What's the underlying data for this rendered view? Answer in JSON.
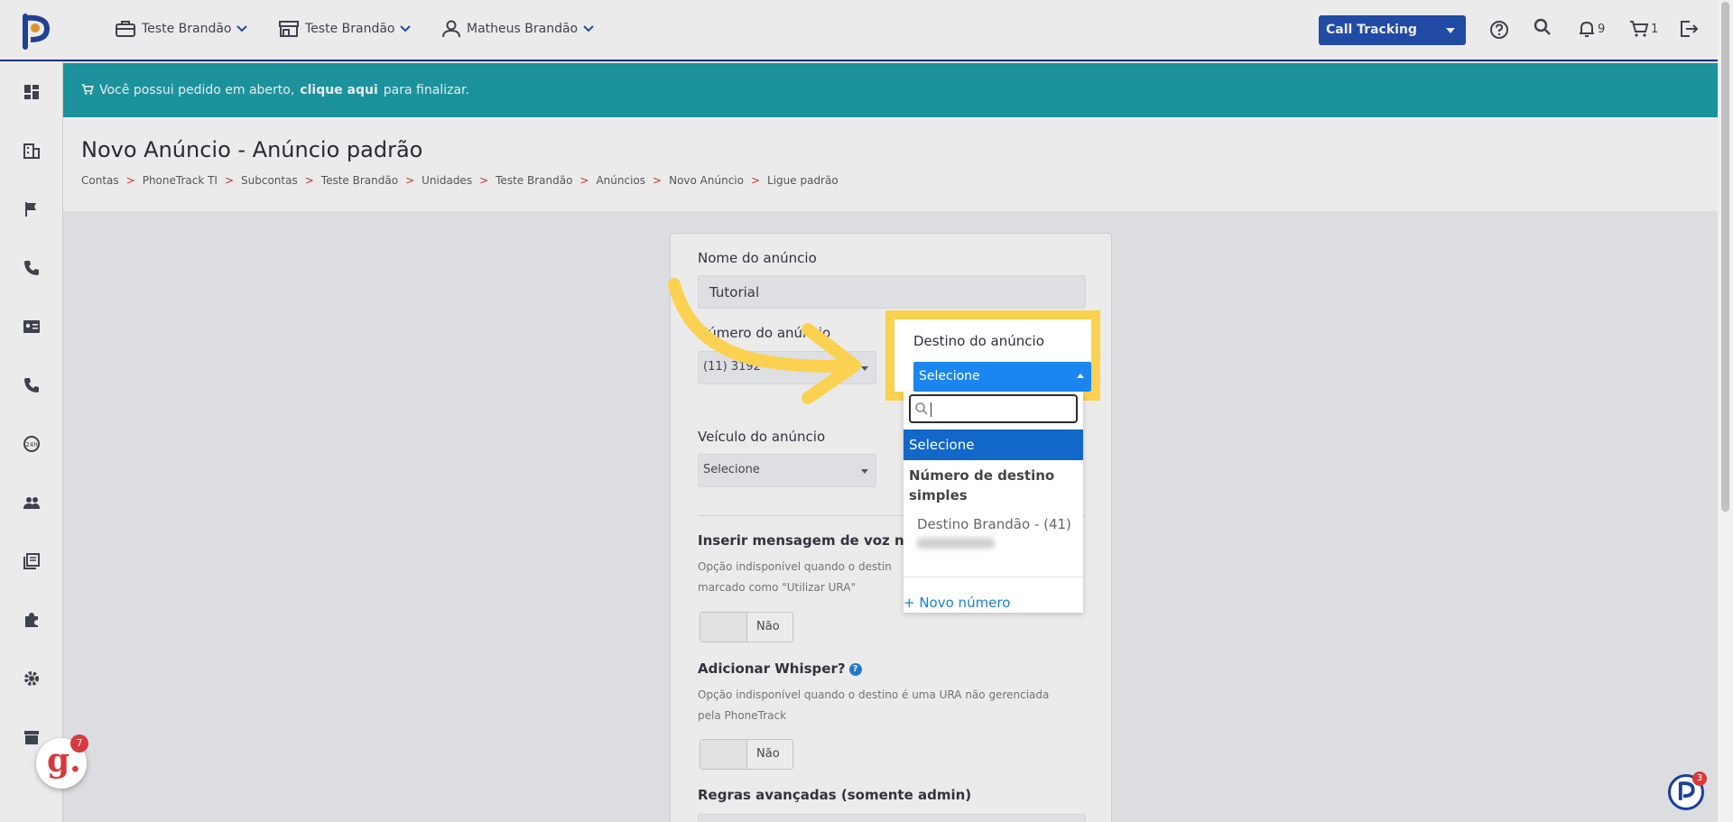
{
  "header": {
    "nav": [
      {
        "label": "Teste Brandão",
        "icon": "briefcase-icon"
      },
      {
        "label": "Teste Brandão",
        "icon": "store-icon"
      },
      {
        "label": "Matheus Brandão",
        "icon": "user-icon"
      }
    ],
    "product_select": "Call Tracking",
    "notifications_count": "9",
    "cart_count": "1"
  },
  "banner": {
    "text_before": "Você possui pedido em aberto,",
    "link": "clique aqui",
    "text_after": "para finalizar."
  },
  "page": {
    "title": "Novo Anúncio - Anúncio padrão",
    "breadcrumb": [
      "Contas",
      "PhoneTrack TI",
      "Subcontas",
      "Teste Brandão",
      "Unidades",
      "Teste Brandão",
      "Anúncios",
      "Novo Anúncio",
      "Ligue padrão"
    ]
  },
  "form": {
    "name_label": "Nome do anúncio",
    "name_value": "Tutorial",
    "number_label": "Número do anúncio",
    "number_value": "(11) 3192-",
    "destination_label": "Destino do anúncio",
    "destination_value": "Selecione",
    "vehicle_label": "Veículo do anúncio",
    "vehicle_value": "Selecione",
    "voice_label": "Inserir mensagem de voz na ch",
    "voice_hint_line1": "Opção indisponível quando o destin",
    "voice_hint_line2": "marcado como \"Utilizar URA\"",
    "voice_toggle": "Não",
    "whisper_label": "Adicionar Whisper?",
    "whisper_help": "?",
    "whisper_hint_line1": "Opção indisponível quando o destino é uma URA não gerenciada",
    "whisper_hint_line2": "pela PhoneTrack",
    "whisper_toggle": "Não",
    "advanced_label": "Regras avançadas (somente admin)"
  },
  "dropdown": {
    "search_placeholder": "",
    "selected_option": "Selecione",
    "group_label": "Número de destino simples",
    "option": "Destino Brandão - (41)",
    "new_link": "+ Novo número"
  },
  "widgets": {
    "g_letter": "g.",
    "g_count": "7",
    "chat_count": "3"
  },
  "colors": {
    "accent": "#1a48b0",
    "banner": "#139aa6",
    "highlight": "#fad150",
    "selected": "#1b86f0"
  }
}
